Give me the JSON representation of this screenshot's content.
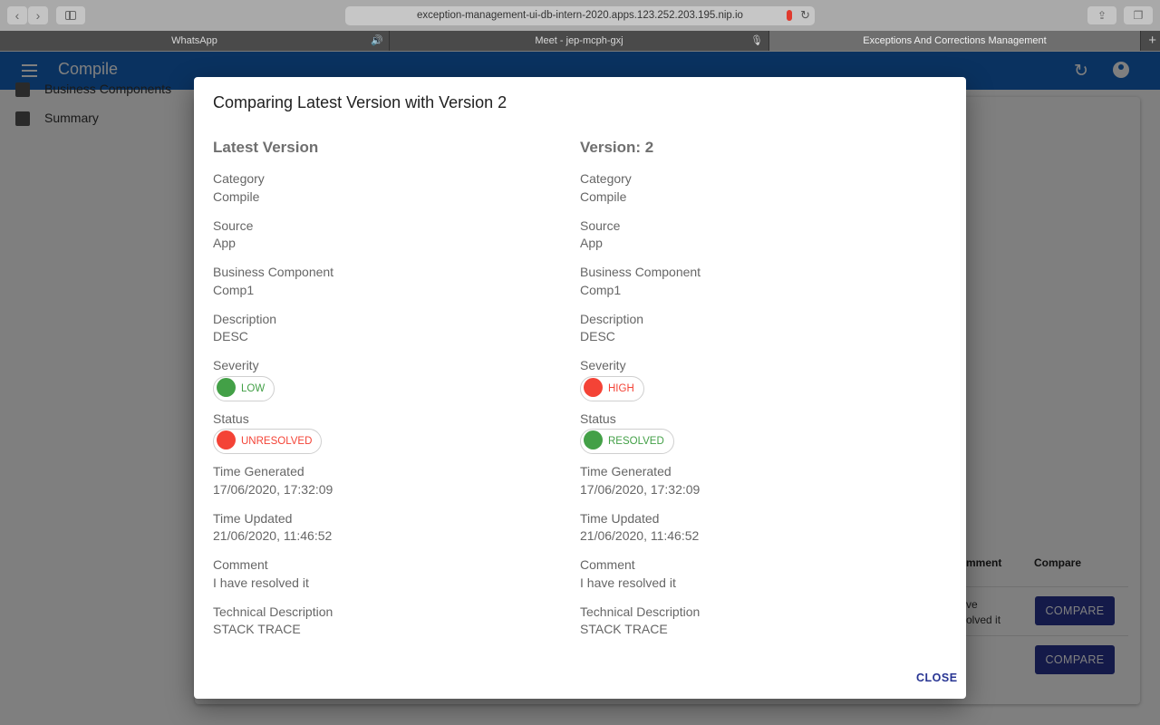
{
  "browser": {
    "url": "exception-management-ui-db-intern-2020.apps.123.252.203.195.nip.io",
    "tabs": [
      {
        "label": "WhatsApp"
      },
      {
        "label": "Meet - jep-mcph-gxj"
      },
      {
        "label": "Exceptions And Corrections Management"
      }
    ]
  },
  "app": {
    "title": "Compile"
  },
  "sidebar": {
    "items": [
      {
        "label": "Business Components"
      },
      {
        "label": "Summary"
      }
    ]
  },
  "table": {
    "headers": {
      "comment": "mment",
      "compare": "Compare"
    },
    "rows": [
      {
        "comment_line1": "ve",
        "comment_line2": "olved it",
        "compare_label": "COMPARE"
      },
      {
        "compare_label": "COMPARE"
      }
    ]
  },
  "dialog": {
    "title": "Comparing Latest Version with Version 2",
    "close_label": "CLOSE",
    "left": {
      "heading": "Latest Version",
      "category_label": "Category",
      "category": "Compile",
      "source_label": "Source",
      "source": "App",
      "component_label": "Business Component",
      "component": "Comp1",
      "description_label": "Description",
      "description": "DESC",
      "severity_label": "Severity",
      "severity": "LOW",
      "severity_color": "#43a047",
      "status_label": "Status",
      "status": "UNRESOLVED",
      "status_color": "#f44336",
      "time_generated_label": "Time Generated",
      "time_generated": "17/06/2020, 17:32:09",
      "time_updated_label": "Time Updated",
      "time_updated": "21/06/2020, 11:46:52",
      "comment_label": "Comment",
      "comment": "I have resolved it",
      "tech_label": "Technical Description",
      "tech": "STACK TRACE"
    },
    "right": {
      "heading": "Version: 2",
      "category_label": "Category",
      "category": "Compile",
      "source_label": "Source",
      "source": "App",
      "component_label": "Business Component",
      "component": "Comp1",
      "description_label": "Description",
      "description": "DESC",
      "severity_label": "Severity",
      "severity": "HIGH",
      "severity_color": "#f44336",
      "status_label": "Status",
      "status": "RESOLVED",
      "status_color": "#43a047",
      "time_generated_label": "Time Generated",
      "time_generated": "17/06/2020, 17:32:09",
      "time_updated_label": "Time Updated",
      "time_updated": "21/06/2020, 11:46:52",
      "comment_label": "Comment",
      "comment": "I have resolved it",
      "tech_label": "Technical Description",
      "tech": "STACK TRACE"
    }
  }
}
